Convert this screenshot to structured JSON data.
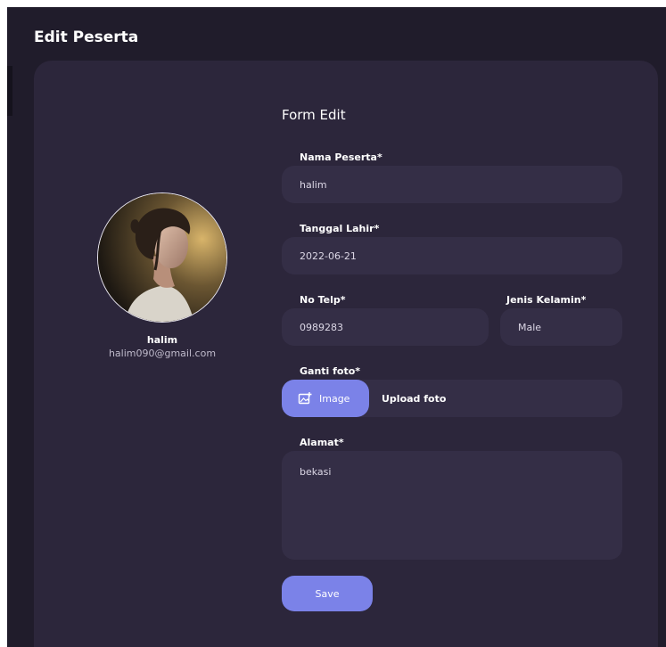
{
  "page": {
    "title": "Edit Peserta"
  },
  "profile": {
    "name": "halim",
    "email": "halim090@gmail.com"
  },
  "form": {
    "title": "Form Edit",
    "nama": {
      "label": "Nama Peserta*",
      "value": "halim"
    },
    "tanggal": {
      "label": "Tanggal Lahir*",
      "value": "2022-06-21"
    },
    "telp": {
      "label": "No Telp*",
      "value": "0989283"
    },
    "gender": {
      "label": "Jenis Kelamin*",
      "value": "Male"
    },
    "foto": {
      "label": "Ganti foto*",
      "button": "Image",
      "hint": "Upload foto",
      "icon": "image-add-icon"
    },
    "alamat": {
      "label": "Alamat*",
      "value": "bekasi"
    },
    "save_label": "Save"
  },
  "colors": {
    "background": "#201c2b",
    "card": "#2c263b",
    "field": "#342e46",
    "accent": "#7b82e8"
  }
}
